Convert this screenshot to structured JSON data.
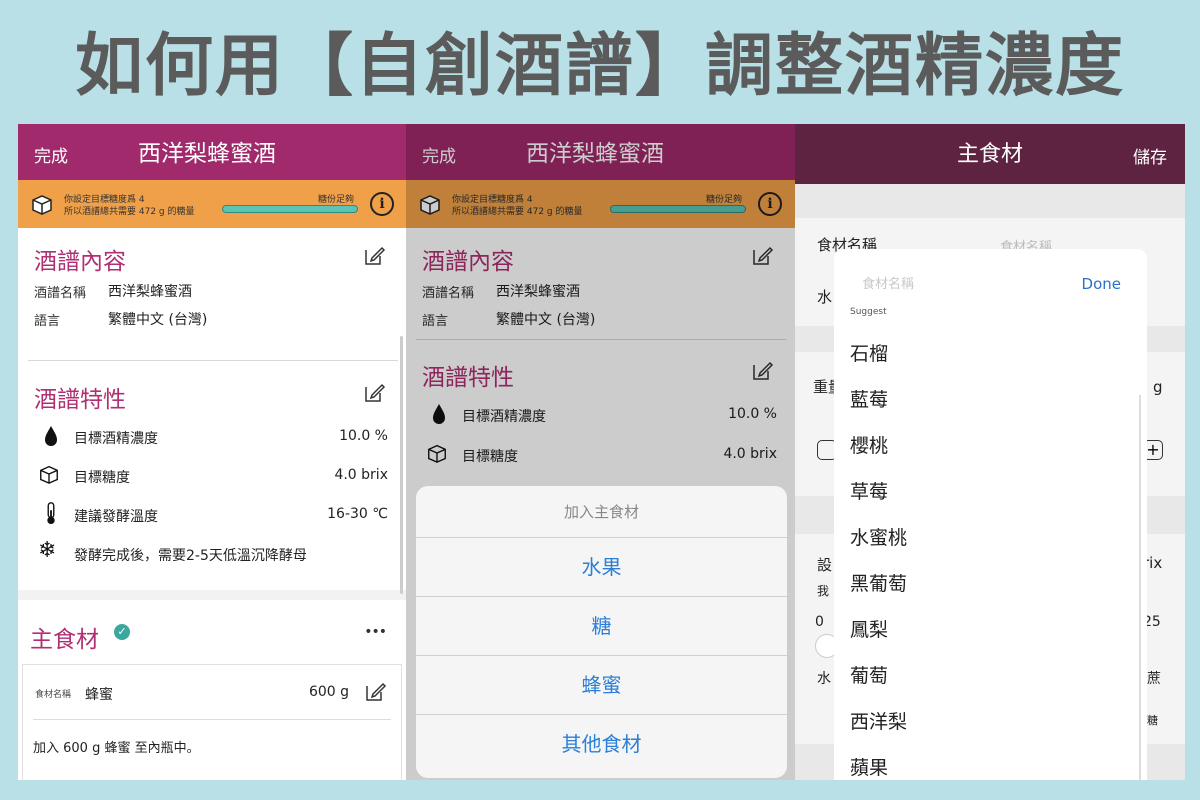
{
  "title": "如何用【自創酒譜】調整酒精濃度",
  "panel1": {
    "nav": {
      "done": "完成",
      "title": "西洋梨蜂蜜酒"
    },
    "banner": {
      "line1": "你設定目標糖度爲 4",
      "line2": "所以酒譜總共需要 472 g 的糖量",
      "label": "糖份足夠",
      "progress": 1.0
    },
    "recipe": {
      "heading": "酒譜內容",
      "name_key": "酒譜名稱",
      "name_val": "西洋梨蜂蜜酒",
      "lang_key": "語言",
      "lang_val": "繁體中文 (台灣)"
    },
    "traits": {
      "heading": "酒譜特性",
      "rows": [
        {
          "icon": "droplet-icon",
          "label": "目標酒精濃度",
          "value": "10.0 %"
        },
        {
          "icon": "sugar-cube-icon",
          "label": "目標糖度",
          "value": "4.0 brix"
        },
        {
          "icon": "thermometer-icon",
          "label": "建議發酵溫度",
          "value": "16-30 ℃"
        },
        {
          "icon": "snowflake-icon",
          "label": "發酵完成後，需要2-5天低溫沉降酵母",
          "value": ""
        }
      ]
    },
    "main": {
      "heading": "主食材",
      "more": "•••",
      "item_key": "食材名稱",
      "item_val": "蜂蜜",
      "item_amt": "600 g",
      "note": "加入 600 g 蜂蜜 至內瓶中。"
    }
  },
  "panel2": {
    "sheet": {
      "title": "加入主食材",
      "options": [
        "水果",
        "糖",
        "蜂蜜",
        "其他食材"
      ]
    }
  },
  "panel3": {
    "nav": {
      "title": "主食材",
      "save": "儲存"
    },
    "bg": {
      "name_label": "食材名稱",
      "name_ph": "食材名稱",
      "water": "水",
      "weight": "重量",
      "unit": "g",
      "set": "設",
      "me": "我",
      "zero": "0",
      "brix": "rix",
      "twentyfive": "25",
      "sugarcane": "蔗",
      "water2": "水",
      "sugar": "糖"
    },
    "popup": {
      "placeholder": "食材名稱",
      "done": "Done",
      "suggest": "Suggest",
      "items": [
        "石榴",
        "藍莓",
        "櫻桃",
        "草莓",
        "水蜜桃",
        "黑葡萄",
        "鳳梨",
        "葡萄",
        "西洋梨",
        "蘋果"
      ]
    }
  }
}
